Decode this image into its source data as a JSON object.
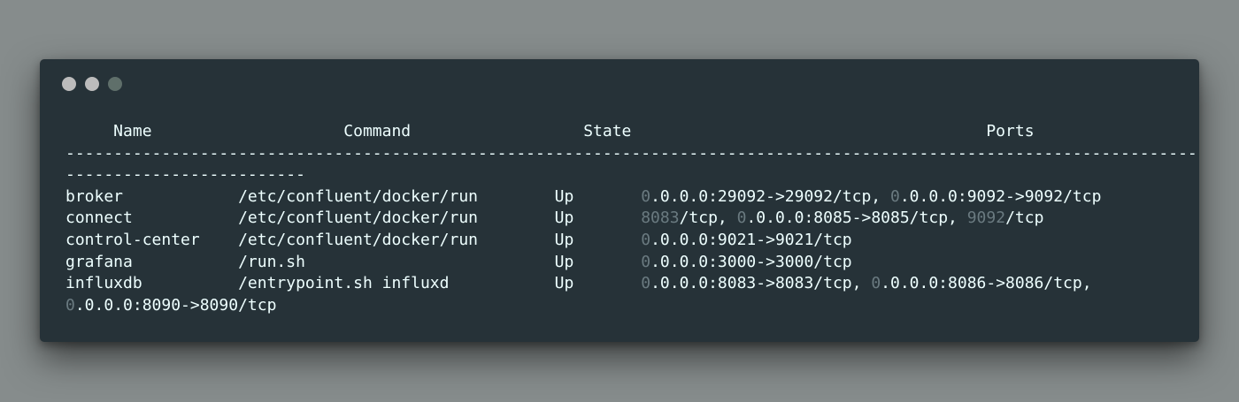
{
  "window": {
    "dots": [
      {
        "name": "close",
        "color": "#bcbcbc"
      },
      {
        "name": "minimize",
        "color": "#bcbcbc"
      },
      {
        "name": "maximize",
        "color": "#5f6f6a"
      }
    ]
  },
  "terminal": {
    "lines": [
      [
        {
          "t": "     Name                    Command                  State                                     Ports"
        }
      ],
      [
        {
          "t": "-----------------------------------------------------------------------------------------------------------------------------"
        }
      ],
      [
        {
          "t": "-------------------------"
        }
      ],
      [
        {
          "t": "broker            /etc/confluent/docker/run        Up       "
        },
        {
          "t": "0",
          "dim": true
        },
        {
          "t": ".0.0.0:29092->29092/tcp, "
        },
        {
          "t": "0",
          "dim": true
        },
        {
          "t": ".0.0.0:9092->9092/tcp"
        }
      ],
      [
        {
          "t": "connect           /etc/confluent/docker/run        Up       "
        },
        {
          "t": "8083",
          "dim": true
        },
        {
          "t": "/tcp, "
        },
        {
          "t": "0",
          "dim": true
        },
        {
          "t": ".0.0.0:8085->8085/tcp, "
        },
        {
          "t": "9092",
          "dim": true
        },
        {
          "t": "/tcp"
        }
      ],
      [
        {
          "t": "control-center    /etc/confluent/docker/run        Up       "
        },
        {
          "t": "0",
          "dim": true
        },
        {
          "t": ".0.0.0:9021->9021/tcp"
        }
      ],
      [
        {
          "t": "grafana           /run.sh                          Up       "
        },
        {
          "t": "0",
          "dim": true
        },
        {
          "t": ".0.0.0:3000->3000/tcp"
        }
      ],
      [
        {
          "t": "influxdb          /entrypoint.sh influxd           Up       "
        },
        {
          "t": "0",
          "dim": true
        },
        {
          "t": ".0.0.0:8083->8083/tcp, "
        },
        {
          "t": "0",
          "dim": true
        },
        {
          "t": ".0.0.0:8086->8086/tcp,"
        }
      ],
      [
        {
          "t": "0",
          "dim": true
        },
        {
          "t": ".0.0.0:8090->8090/tcp"
        }
      ]
    ]
  }
}
